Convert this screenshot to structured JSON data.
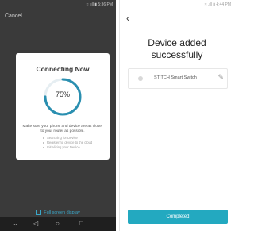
{
  "left": {
    "status_text": "≈ .ıll ▮ 5:36 PM",
    "cancel": "Cancel",
    "modal": {
      "title": "Connecting Now",
      "progress_text": "75%",
      "progress_value": 0.75,
      "hint": "Make sure your phone and device are as closer to your router as possible.",
      "steps": [
        "Searching for Device",
        "Registering device to the cloud",
        "Initializing your Device"
      ]
    },
    "fullscreen": "Full screen display",
    "nav": {
      "down": "⌄",
      "back": "◁",
      "home": "○",
      "recent": "□"
    }
  },
  "right": {
    "status_text": "≈ .ıll ▮ 4:44 PM",
    "back_icon": "‹",
    "title_line1": "Device added",
    "title_line2": "successfully",
    "device_name": "STITCH Smart Switch",
    "edit_icon": "✎",
    "completed": "Completed"
  },
  "colors": {
    "accent": "#23a9c0",
    "ring": "#2a8fb0",
    "dark_bg": "#3a3a3a"
  }
}
